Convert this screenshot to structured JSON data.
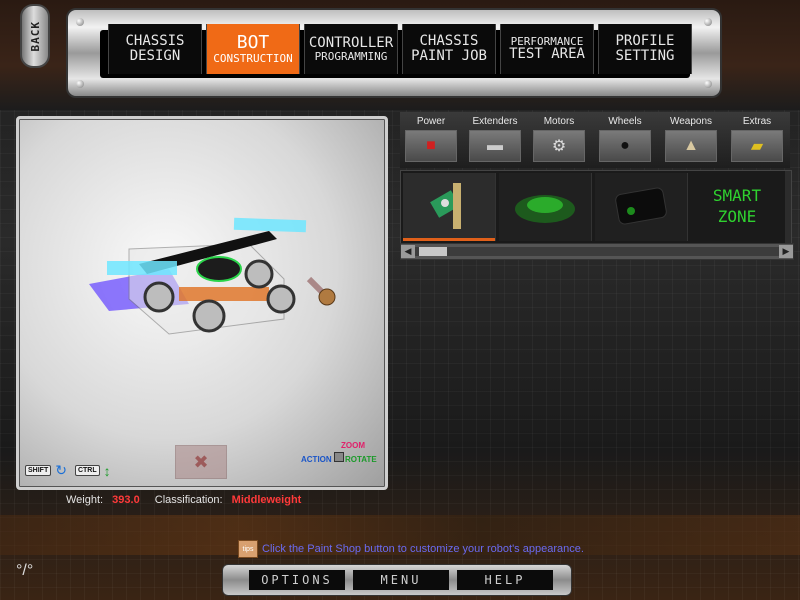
{
  "back_button": {
    "label": "BACK"
  },
  "nav": {
    "tabs": [
      {
        "line1": "CHASSIS",
        "line2": "DESIGN",
        "active": false
      },
      {
        "line1": "BOT",
        "line2": "CONSTRUCTION",
        "active": true
      },
      {
        "line1": "CONTROLLER",
        "line2": "PROGRAMMING",
        "active": false
      },
      {
        "line1": "CHASSIS",
        "line2": "PAINT JOB",
        "active": false
      },
      {
        "line1": "PERFORMANCE",
        "line2": "TEST AREA",
        "active": false
      },
      {
        "line1": "PROFILE",
        "line2": "SETTING",
        "active": false
      }
    ]
  },
  "viewport": {
    "shift_key": "SHIFT",
    "ctrl_key": "CTRL",
    "zoom_label": "ZOOM",
    "action_label": "ACTION",
    "rotate_label": "ROTATE"
  },
  "parts": {
    "categories": [
      {
        "label": "Power",
        "icon": "battery-icon"
      },
      {
        "label": "Extenders",
        "icon": "extender-icon"
      },
      {
        "label": "Motors",
        "icon": "motor-icon"
      },
      {
        "label": "Wheels",
        "icon": "wheel-icon"
      },
      {
        "label": "Weapons",
        "icon": "weapon-icon"
      },
      {
        "label": "Extras",
        "icon": "extras-icon"
      }
    ],
    "smart_zone_line1": "SMART",
    "smart_zone_line2": "ZONE"
  },
  "stats": {
    "weight_label": "Weight:",
    "weight_value": "393.0",
    "class_label": "Classification:",
    "class_value": "Middleweight"
  },
  "tip": {
    "icon_text": "tips",
    "text": "Click the Paint Shop button to customize your robot's appearance."
  },
  "bottom": {
    "options": "OPTIONS",
    "menu": "MENU",
    "help": "HELP"
  },
  "colors": {
    "accent": "#f06a16",
    "weight_red": "#ff3a3a",
    "smart_green": "#2fd12f",
    "tip_blue": "#6a6af0"
  }
}
